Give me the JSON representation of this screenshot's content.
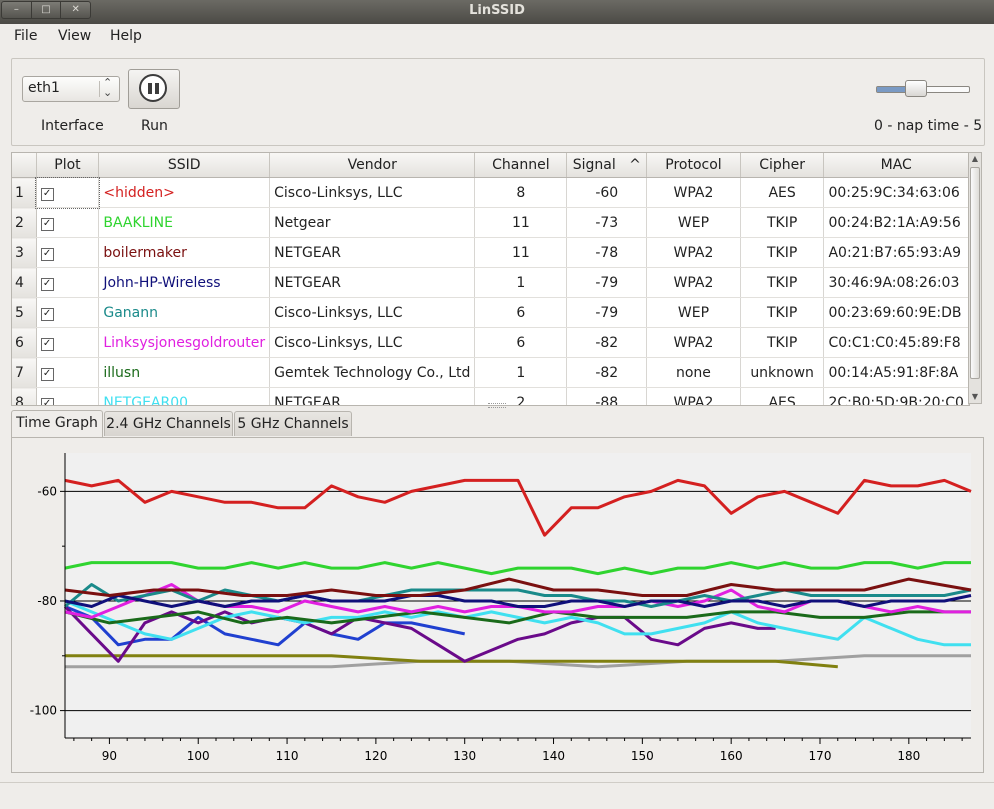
{
  "window": {
    "title": "LinSSID",
    "buttons": [
      "–",
      "□",
      "✕"
    ]
  },
  "menu": {
    "file": "File",
    "view": "View",
    "help": "Help"
  },
  "controls": {
    "interface_value": "eth1",
    "interface_label": "Interface",
    "run_label": "Run",
    "nap_label": "0 - nap time - 5",
    "nap_value": 2
  },
  "table": {
    "headers": {
      "plot": "Plot",
      "ssid": "SSID",
      "vendor": "Vendor",
      "channel": "Channel",
      "signal": "Signal",
      "protocol": "Protocol",
      "cipher": "Cipher",
      "mac": "MAC"
    },
    "sort_indicator": "^",
    "rows": [
      {
        "num": "1",
        "ssid": "<hidden>",
        "color": "#d42020",
        "vendor": "Cisco-Linksys, LLC",
        "channel": "8",
        "signal": "-60",
        "protocol": "WPA2",
        "cipher": "AES",
        "mac": "00:25:9C:34:63:06"
      },
      {
        "num": "2",
        "ssid": "BAAKLINE",
        "color": "#2fd42f",
        "vendor": "Netgear",
        "channel": "11",
        "signal": "-73",
        "protocol": "WEP",
        "cipher": "TKIP",
        "mac": "00:24:B2:1A:A9:56"
      },
      {
        "num": "3",
        "ssid": "boilermaker",
        "color": "#7a1010",
        "vendor": "NETGEAR",
        "channel": "11",
        "signal": "-78",
        "protocol": "WPA2",
        "cipher": "TKIP",
        "mac": "A0:21:B7:65:93:A9"
      },
      {
        "num": "4",
        "ssid": "John-HP-Wireless",
        "color": "#10107a",
        "vendor": "NETGEAR",
        "channel": "1",
        "signal": "-79",
        "protocol": "WPA2",
        "cipher": "TKIP",
        "mac": "30:46:9A:08:26:03"
      },
      {
        "num": "5",
        "ssid": "Ganann",
        "color": "#1a8a8a",
        "vendor": "Cisco-Linksys, LLC",
        "channel": "6",
        "signal": "-79",
        "protocol": "WEP",
        "cipher": "TKIP",
        "mac": "00:23:69:60:9E:DB"
      },
      {
        "num": "6",
        "ssid": "Linksysjonesgoldrouter",
        "color": "#e020e0",
        "vendor": "Cisco-Linksys, LLC",
        "channel": "6",
        "signal": "-82",
        "protocol": "WPA2",
        "cipher": "TKIP",
        "mac": "C0:C1:C0:45:89:F8"
      },
      {
        "num": "7",
        "ssid": "illusn",
        "color": "#1a6a1a",
        "vendor": "Gemtek Technology Co., Ltd",
        "channel": "1",
        "signal": "-82",
        "protocol": "none",
        "cipher": "unknown",
        "mac": "00:14:A5:91:8F:8A"
      },
      {
        "num": "8",
        "ssid": "NETGEAR00",
        "color": "#40e0f0",
        "vendor": "NETGEAR",
        "channel": "2",
        "signal": "-88",
        "protocol": "WPA2",
        "cipher": "AES",
        "mac": "2C:B0:5D:9B:20:C0"
      }
    ]
  },
  "tabs": [
    "Time Graph",
    "2.4 GHz Channels",
    "5 GHz Channels"
  ],
  "chart_data": {
    "type": "line",
    "x_ticks": [
      "90",
      "100",
      "110",
      "120",
      "130",
      "140",
      "150",
      "160",
      "170",
      "180"
    ],
    "y_ticks": [
      "-60",
      "-80",
      "-100"
    ],
    "xlim": [
      85,
      187
    ],
    "ylim": [
      -105,
      -53
    ],
    "series": [
      {
        "name": "<hidden>",
        "color": "#d42020",
        "x": [
          85,
          88,
          91,
          94,
          97,
          100,
          103,
          106,
          109,
          112,
          115,
          118,
          121,
          124,
          127,
          130,
          133,
          136,
          139,
          142,
          145,
          148,
          151,
          154,
          157,
          160,
          163,
          166,
          169,
          172,
          175,
          178,
          181,
          184,
          187
        ],
        "y": [
          -58,
          -59,
          -58,
          -62,
          -60,
          -61,
          -62,
          -62,
          -63,
          -63,
          -59,
          -61,
          -62,
          -60,
          -59,
          -58,
          -58,
          -58,
          -68,
          -63,
          -63,
          -61,
          -60,
          -58,
          -59,
          -64,
          -61,
          -60,
          -62,
          -64,
          -58,
          -59,
          -59,
          -58,
          -60
        ]
      },
      {
        "name": "BAAKLINE",
        "color": "#2fd42f",
        "x": [
          85,
          88,
          91,
          94,
          97,
          100,
          103,
          106,
          109,
          112,
          115,
          118,
          121,
          124,
          127,
          130,
          133,
          136,
          139,
          142,
          145,
          148,
          151,
          154,
          157,
          160,
          163,
          166,
          169,
          172,
          175,
          178,
          181,
          184,
          187
        ],
        "y": [
          -74,
          -73,
          -73,
          -73,
          -73,
          -74,
          -74,
          -73,
          -74,
          -73,
          -74,
          -74,
          -73,
          -74,
          -73,
          -74,
          -75,
          -74,
          -74,
          -74,
          -75,
          -74,
          -75,
          -74,
          -74,
          -73,
          -74,
          -73,
          -74,
          -74,
          -73,
          -73,
          -74,
          -73,
          -73
        ]
      },
      {
        "name": "boilermaker",
        "color": "#7a1010",
        "x": [
          85,
          90,
          95,
          100,
          105,
          110,
          115,
          120,
          125,
          130,
          135,
          140,
          145,
          150,
          155,
          160,
          165,
          170,
          175,
          180,
          187
        ],
        "y": [
          -78,
          -79,
          -78,
          -78,
          -79,
          -79,
          -78,
          -79,
          -79,
          -78,
          -76,
          -78,
          -78,
          -79,
          -79,
          -77,
          -78,
          -78,
          -78,
          -76,
          -78
        ]
      },
      {
        "name": "John-HP-Wireless",
        "color": "#10107a",
        "x": [
          85,
          88,
          91,
          94,
          97,
          100,
          103,
          106,
          109,
          112,
          115,
          118,
          121,
          124,
          127,
          130,
          133,
          136,
          139,
          142,
          145,
          148,
          151,
          154,
          157,
          160,
          163,
          166,
          169,
          172,
          175,
          178,
          181,
          184,
          187
        ],
        "y": [
          -80,
          -81,
          -79,
          -80,
          -81,
          -80,
          -81,
          -80,
          -80,
          -79,
          -80,
          -80,
          -80,
          -79,
          -79,
          -80,
          -80,
          -81,
          -81,
          -80,
          -80,
          -81,
          -80,
          -80,
          -81,
          -80,
          -80,
          -81,
          -80,
          -80,
          -81,
          -80,
          -80,
          -80,
          -79
        ]
      },
      {
        "name": "Ganann",
        "color": "#1a8a8a",
        "x": [
          85,
          88,
          91,
          94,
          97,
          100,
          103,
          106,
          109,
          112,
          115,
          118,
          121,
          124,
          127,
          130,
          133,
          136,
          139,
          142,
          145,
          148,
          151,
          154,
          157,
          160,
          163,
          166,
          169,
          172,
          175,
          178,
          181,
          184,
          187
        ],
        "y": [
          -81,
          -77,
          -80,
          -79,
          -78,
          -80,
          -78,
          -79,
          -80,
          -79,
          -80,
          -80,
          -79,
          -78,
          -78,
          -78,
          -78,
          -78,
          -79,
          -79,
          -80,
          -80,
          -81,
          -80,
          -79,
          -80,
          -79,
          -78,
          -79,
          -79,
          -79,
          -79,
          -79,
          -79,
          -78
        ]
      },
      {
        "name": "Linksysjonesgoldrouter",
        "color": "#e020e0",
        "x": [
          85,
          88,
          91,
          94,
          97,
          100,
          103,
          106,
          109,
          112,
          115,
          118,
          121,
          124,
          127,
          130,
          133,
          136,
          139,
          142,
          145,
          148,
          151,
          154,
          157,
          160,
          163,
          166,
          169,
          172,
          175,
          178,
          181,
          184,
          187
        ],
        "y": [
          -82,
          -83,
          -81,
          -79,
          -77,
          -80,
          -81,
          -81,
          -82,
          -80,
          -81,
          -82,
          -81,
          -82,
          -81,
          -82,
          -81,
          -81,
          -82,
          -82,
          -81,
          -81,
          -80,
          -81,
          -80,
          -78,
          -81,
          -82,
          -80,
          -80,
          -81,
          -82,
          -81,
          -82,
          -82
        ]
      },
      {
        "name": "illusn",
        "color": "#1a6a1a",
        "x": [
          85,
          90,
          95,
          100,
          105,
          110,
          115,
          120,
          125,
          130,
          135,
          140,
          145,
          150,
          155,
          160,
          165,
          170,
          175,
          180,
          187
        ],
        "y": [
          -82,
          -84,
          -83,
          -82,
          -84,
          -83,
          -84,
          -83,
          -82,
          -83,
          -84,
          -82,
          -83,
          -83,
          -83,
          -82,
          -82,
          -83,
          -83,
          -82,
          -82
        ]
      },
      {
        "name": "NETGEAR00",
        "color": "#40e0f0",
        "x": [
          85,
          88,
          91,
          94,
          97,
          100,
          103,
          106,
          109,
          112,
          115,
          118,
          121,
          124,
          127,
          130,
          133,
          136,
          139,
          142,
          145,
          148,
          151,
          154,
          157,
          160,
          163,
          166,
          169,
          172,
          175,
          178,
          181,
          184,
          187
        ],
        "y": [
          -80,
          -82,
          -84,
          -86,
          -87,
          -85,
          -83,
          -82,
          -83,
          -84,
          -83,
          -83,
          -82,
          -83,
          -82,
          -83,
          -82,
          -83,
          -84,
          -83,
          -84,
          -86,
          -86,
          -85,
          -84,
          -82,
          -84,
          -85,
          -86,
          -87,
          -83,
          -85,
          -87,
          -88,
          -88
        ]
      },
      {
        "name": "purple",
        "color": "#6a0a8a",
        "x": [
          85,
          88,
          91,
          94,
          97,
          100,
          103,
          106,
          109,
          112,
          115,
          118,
          121,
          124,
          127,
          130,
          133,
          136,
          139,
          142,
          145,
          148,
          151,
          154,
          157,
          160,
          163,
          165
        ],
        "y": [
          -81,
          -86,
          -91,
          -84,
          -82,
          -84,
          -82,
          -84,
          -83,
          -84,
          -86,
          -83,
          -84,
          -85,
          -88,
          -91,
          -89,
          -87,
          -86,
          -84,
          -83,
          -83,
          -87,
          -88,
          -85,
          -84,
          -85,
          -85
        ]
      },
      {
        "name": "blue",
        "color": "#2040d0",
        "x": [
          85,
          88,
          91,
          94,
          97,
          100,
          103,
          106,
          109,
          112,
          115,
          118,
          121,
          124,
          127,
          130
        ],
        "y": [
          -81,
          -83,
          -88,
          -87,
          -87,
          -83,
          -86,
          -87,
          -88,
          -84,
          -86,
          -87,
          -84,
          -84,
          -85,
          -86
        ]
      },
      {
        "name": "olive",
        "color": "#808010",
        "x": [
          85,
          95,
          105,
          115,
          125,
          135,
          145,
          155,
          165,
          172
        ],
        "y": [
          -90,
          -90,
          -90,
          -90,
          -91,
          -91,
          -91,
          -91,
          -91,
          -92
        ]
      },
      {
        "name": "gray",
        "color": "#a0a0a0",
        "x": [
          85,
          95,
          105,
          115,
          125,
          135,
          145,
          155,
          165,
          175,
          187
        ],
        "y": [
          -92,
          -92,
          -92,
          -92,
          -91,
          -91,
          -92,
          -91,
          -91,
          -90,
          -90
        ]
      }
    ]
  }
}
